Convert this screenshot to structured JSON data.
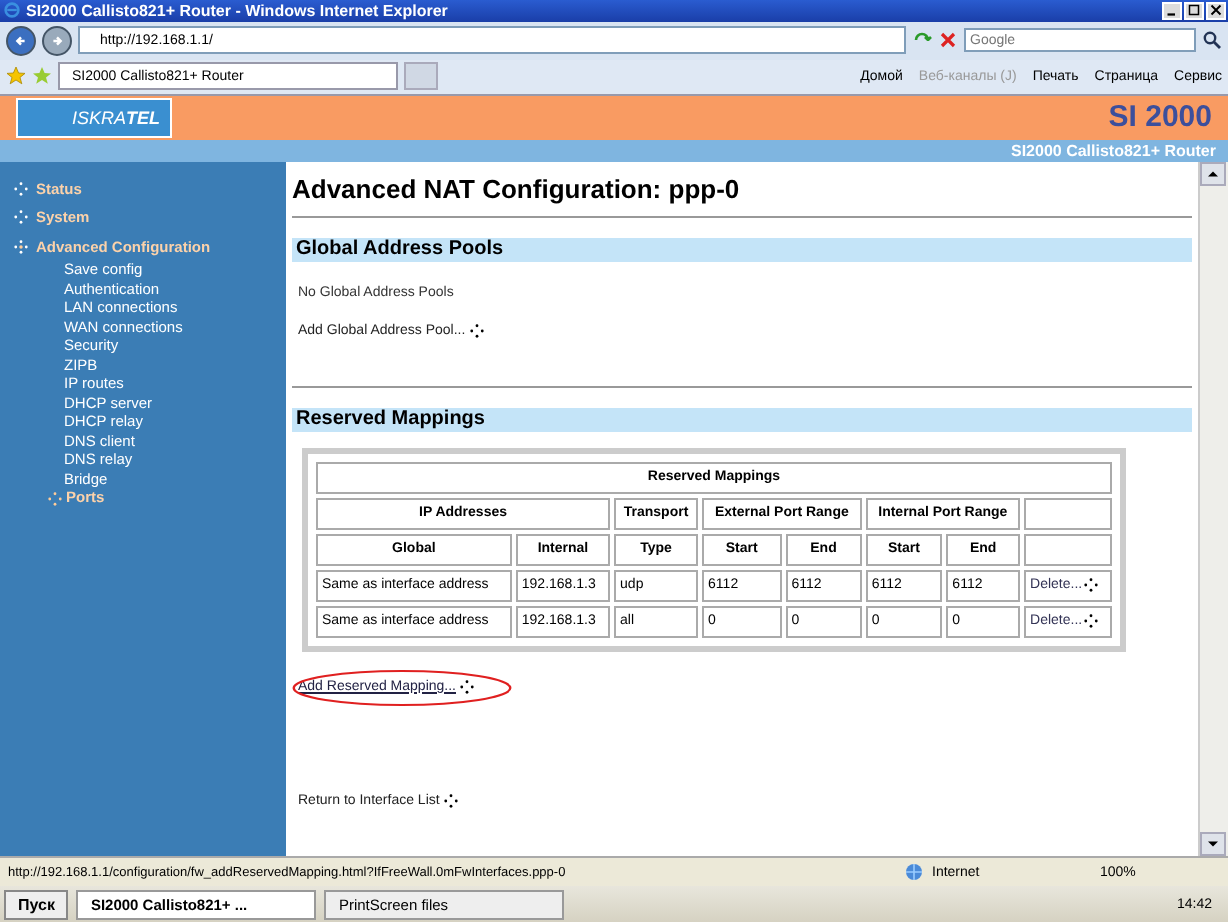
{
  "window": {
    "title": "SI2000 Callisto821+ Router - Windows Internet Explorer"
  },
  "address_bar": {
    "url": "http://192.168.1.1/",
    "search_placeholder": "Google"
  },
  "tabs": [
    {
      "label": "SI2000 Callisto821+ Router",
      "selected": true
    }
  ],
  "command_bar": [
    {
      "label": "Домой",
      "disabled": false
    },
    {
      "label": "Веб-каналы (J)",
      "disabled": true
    },
    {
      "label": "Печать",
      "disabled": false
    },
    {
      "label": "Страница",
      "disabled": false
    },
    {
      "label": "Сервис",
      "disabled": false
    }
  ],
  "banner": {
    "logo": "ISKRA**TEL**",
    "product": "SI 2000",
    "subtitle": "SI2000 Callisto821+ Router"
  },
  "sidebar": {
    "items": [
      {
        "label": "Status",
        "expanded": false
      },
      {
        "label": "System",
        "expanded": false
      },
      {
        "label": "Advanced Configuration",
        "expanded": true,
        "children": [
          {
            "label": "Save config",
            "selected": false
          },
          {
            "label": "Authentication",
            "selected": false
          },
          {
            "label": "LAN connections",
            "selected": false
          },
          {
            "label": "WAN connections",
            "selected": false
          },
          {
            "label": "Security",
            "selected": false
          },
          {
            "label": "ZIPB",
            "selected": false
          },
          {
            "label": "IP routes",
            "selected": false
          },
          {
            "label": "DHCP server",
            "selected": false
          },
          {
            "label": "DHCP relay",
            "selected": false
          },
          {
            "label": "DNS client",
            "selected": false
          },
          {
            "label": "DNS relay",
            "selected": false
          },
          {
            "label": "Bridge",
            "selected": false
          },
          {
            "label": "Ports",
            "selected": true
          }
        ]
      }
    ]
  },
  "content": {
    "title": "Advanced NAT Configuration: ppp-0",
    "global_pools": {
      "heading": "Global Address Pools",
      "message": "No Global Address Pools",
      "add_link": "Add Global Address Pool..."
    },
    "reserved": {
      "heading": "Reserved Mappings",
      "table": {
        "title": "Reserved Mappings",
        "groups": [
          {
            "label": "IP Addresses",
            "columns": [
              "Global",
              "Internal"
            ]
          },
          {
            "label": "Transport",
            "columns": [
              "Type"
            ]
          },
          {
            "label": "External Port Range",
            "columns": [
              "Start",
              "End"
            ]
          },
          {
            "label": "Internal Port Range",
            "columns": [
              "Start",
              "End"
            ]
          }
        ],
        "rows": [
          {
            "cells": [
              "Same as interface address",
              "192.168.1.3",
              "udp",
              "6112",
              "6112",
              "6112",
              "6112"
            ],
            "action": "Delete..."
          },
          {
            "cells": [
              "Same as interface address",
              "192.168.1.3",
              "all",
              "0",
              "0",
              "0",
              "0"
            ],
            "action": "Delete..."
          }
        ]
      },
      "add_link": "Add Reserved Mapping...",
      "add_link_circled": true
    },
    "return_link": "Return to Interface List"
  },
  "status_bar": {
    "url": "http://192.168.1.1/configuration/fw_addReservedMapping.html?IfFreeWall.0mFwInterfaces.ppp-0",
    "zone": "Internet",
    "zoom": "100%"
  },
  "taskbar": {
    "start": "Пуск",
    "tasks": [
      {
        "label": "SI2000 Callisto821+ ...",
        "selected": true
      },
      {
        "label": "PrintScreen files",
        "selected": false
      }
    ],
    "clock": "14:42"
  }
}
